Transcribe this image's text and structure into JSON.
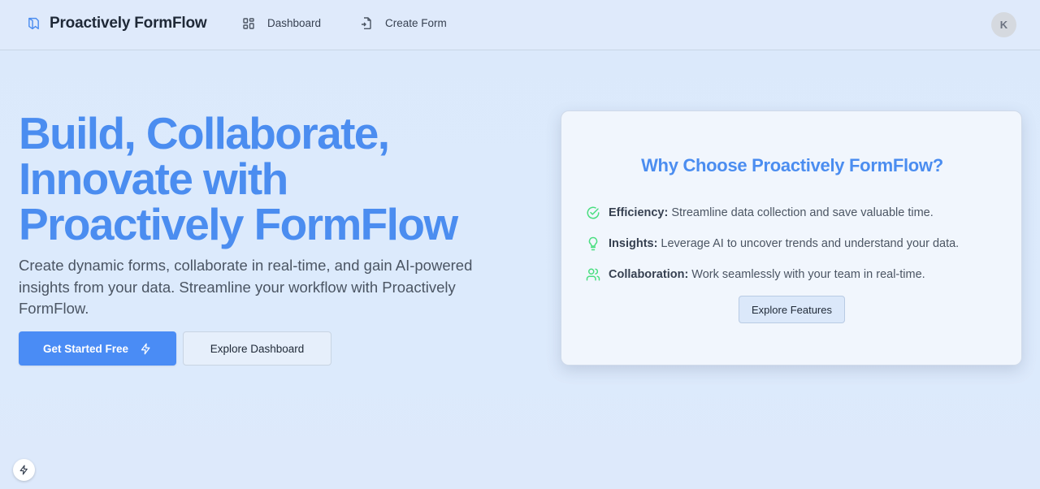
{
  "header": {
    "brand_name": "Proactively FormFlow",
    "nav": {
      "dashboard_label": "Dashboard",
      "create_form_label": "Create Form"
    },
    "avatar_initial": "K"
  },
  "hero": {
    "title": "Build, Collaborate, Innovate with Proactively FormFlow",
    "subtitle": "Create dynamic forms, collaborate in real-time, and gain AI-powered insights from your data. Streamline your workflow with Proactively FormFlow.",
    "primary_button": "Get Started Free",
    "secondary_button": "Explore Dashboard"
  },
  "card": {
    "title": "Why Choose Proactively FormFlow?",
    "features": [
      {
        "label": "Efficiency:",
        "text": "Streamline data collection and save valuable time.",
        "icon": "circle-check-icon"
      },
      {
        "label": "Insights:",
        "text": "Leverage AI to uncover trends and understand your data.",
        "icon": "lightbulb-icon"
      },
      {
        "label": "Collaboration:",
        "text": "Work seamlessly with your team in real-time.",
        "icon": "users-icon"
      }
    ],
    "button": "Explore Features"
  },
  "colors": {
    "accent": "#4b8df0",
    "primary_button": "#4a8cf5",
    "feature_icon": "#4ade80"
  }
}
